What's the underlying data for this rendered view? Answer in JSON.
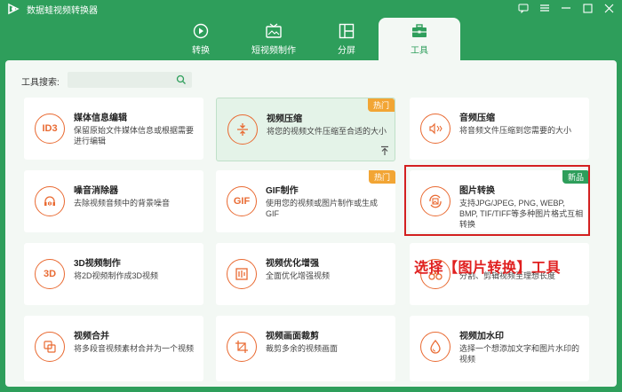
{
  "app": {
    "title": "数据蛙视频转换器"
  },
  "tabs": [
    {
      "label": "转换",
      "icon": "convert-icon",
      "active": false
    },
    {
      "label": "短视频制作",
      "icon": "tv-icon",
      "active": false
    },
    {
      "label": "分屏",
      "icon": "split-screen-icon",
      "active": false
    },
    {
      "label": "工具",
      "icon": "toolbox-icon",
      "active": true
    }
  ],
  "search": {
    "label": "工具搜索:",
    "value": "",
    "placeholder": ""
  },
  "cards": [
    {
      "title": "媒体信息编辑",
      "desc": "保留原始文件媒体信息或根据需要进行编辑",
      "icon_text": "ID3",
      "icon": "id3-icon"
    },
    {
      "title": "视频压缩",
      "desc": "将您的视频文件压缩至合适的大小",
      "icon": "compress-icon",
      "badge": "热门"
    },
    {
      "title": "音频压缩",
      "desc": "将音频文件压缩到您需要的大小",
      "icon": "audio-compress-icon"
    },
    {
      "title": "噪音消除器",
      "desc": "去除视频音频中的背景噪音",
      "icon": "noise-icon"
    },
    {
      "title": "GIF制作",
      "desc": "使用您的视频或图片制作或生成GIF",
      "icon_text": "GIF",
      "icon": "gif-icon",
      "badge": "热门"
    },
    {
      "title": "图片转换",
      "desc": "支持JPG/JPEG, PNG, WEBP, BMP, TIF/TIFF等多种图片格式互相转换",
      "icon": "image-convert-icon",
      "badge": "新品"
    },
    {
      "title": "3D视频制作",
      "desc": "将2D视频制作成3D视频",
      "icon_text": "3D",
      "icon": "3d-icon"
    },
    {
      "title": "视频优化增强",
      "desc": "全面优化增强视频",
      "icon": "enhance-icon"
    },
    {
      "title": "",
      "desc": "分割、剪辑视频至理想长度",
      "icon": "trim-icon"
    },
    {
      "title": "视频合并",
      "desc": "将多段音视频素材合并为一个视频",
      "icon": "merge-icon"
    },
    {
      "title": "视频画面裁剪",
      "desc": "裁剪多余的视频画面",
      "icon": "crop-icon"
    },
    {
      "title": "视频加水印",
      "desc": "选择一个想添加文字和图片水印的视频",
      "icon": "watermark-icon"
    }
  ],
  "annotation": "选择【图片转换】工具",
  "colors": {
    "brand": "#2e9e5b",
    "accent": "#e96a32",
    "hot": "#f2a534",
    "highlight": "#d32020"
  }
}
